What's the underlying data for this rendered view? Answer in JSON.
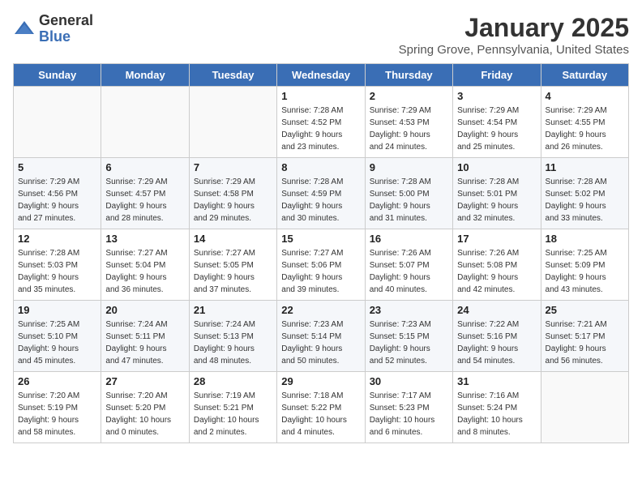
{
  "logo": {
    "general": "General",
    "blue": "Blue"
  },
  "title": "January 2025",
  "location": "Spring Grove, Pennsylvania, United States",
  "days_of_week": [
    "Sunday",
    "Monday",
    "Tuesday",
    "Wednesday",
    "Thursday",
    "Friday",
    "Saturday"
  ],
  "weeks": [
    [
      {
        "day": "",
        "info": ""
      },
      {
        "day": "",
        "info": ""
      },
      {
        "day": "",
        "info": ""
      },
      {
        "day": "1",
        "info": "Sunrise: 7:28 AM\nSunset: 4:52 PM\nDaylight: 9 hours\nand 23 minutes."
      },
      {
        "day": "2",
        "info": "Sunrise: 7:29 AM\nSunset: 4:53 PM\nDaylight: 9 hours\nand 24 minutes."
      },
      {
        "day": "3",
        "info": "Sunrise: 7:29 AM\nSunset: 4:54 PM\nDaylight: 9 hours\nand 25 minutes."
      },
      {
        "day": "4",
        "info": "Sunrise: 7:29 AM\nSunset: 4:55 PM\nDaylight: 9 hours\nand 26 minutes."
      }
    ],
    [
      {
        "day": "5",
        "info": "Sunrise: 7:29 AM\nSunset: 4:56 PM\nDaylight: 9 hours\nand 27 minutes."
      },
      {
        "day": "6",
        "info": "Sunrise: 7:29 AM\nSunset: 4:57 PM\nDaylight: 9 hours\nand 28 minutes."
      },
      {
        "day": "7",
        "info": "Sunrise: 7:29 AM\nSunset: 4:58 PM\nDaylight: 9 hours\nand 29 minutes."
      },
      {
        "day": "8",
        "info": "Sunrise: 7:28 AM\nSunset: 4:59 PM\nDaylight: 9 hours\nand 30 minutes."
      },
      {
        "day": "9",
        "info": "Sunrise: 7:28 AM\nSunset: 5:00 PM\nDaylight: 9 hours\nand 31 minutes."
      },
      {
        "day": "10",
        "info": "Sunrise: 7:28 AM\nSunset: 5:01 PM\nDaylight: 9 hours\nand 32 minutes."
      },
      {
        "day": "11",
        "info": "Sunrise: 7:28 AM\nSunset: 5:02 PM\nDaylight: 9 hours\nand 33 minutes."
      }
    ],
    [
      {
        "day": "12",
        "info": "Sunrise: 7:28 AM\nSunset: 5:03 PM\nDaylight: 9 hours\nand 35 minutes."
      },
      {
        "day": "13",
        "info": "Sunrise: 7:27 AM\nSunset: 5:04 PM\nDaylight: 9 hours\nand 36 minutes."
      },
      {
        "day": "14",
        "info": "Sunrise: 7:27 AM\nSunset: 5:05 PM\nDaylight: 9 hours\nand 37 minutes."
      },
      {
        "day": "15",
        "info": "Sunrise: 7:27 AM\nSunset: 5:06 PM\nDaylight: 9 hours\nand 39 minutes."
      },
      {
        "day": "16",
        "info": "Sunrise: 7:26 AM\nSunset: 5:07 PM\nDaylight: 9 hours\nand 40 minutes."
      },
      {
        "day": "17",
        "info": "Sunrise: 7:26 AM\nSunset: 5:08 PM\nDaylight: 9 hours\nand 42 minutes."
      },
      {
        "day": "18",
        "info": "Sunrise: 7:25 AM\nSunset: 5:09 PM\nDaylight: 9 hours\nand 43 minutes."
      }
    ],
    [
      {
        "day": "19",
        "info": "Sunrise: 7:25 AM\nSunset: 5:10 PM\nDaylight: 9 hours\nand 45 minutes."
      },
      {
        "day": "20",
        "info": "Sunrise: 7:24 AM\nSunset: 5:11 PM\nDaylight: 9 hours\nand 47 minutes."
      },
      {
        "day": "21",
        "info": "Sunrise: 7:24 AM\nSunset: 5:13 PM\nDaylight: 9 hours\nand 48 minutes."
      },
      {
        "day": "22",
        "info": "Sunrise: 7:23 AM\nSunset: 5:14 PM\nDaylight: 9 hours\nand 50 minutes."
      },
      {
        "day": "23",
        "info": "Sunrise: 7:23 AM\nSunset: 5:15 PM\nDaylight: 9 hours\nand 52 minutes."
      },
      {
        "day": "24",
        "info": "Sunrise: 7:22 AM\nSunset: 5:16 PM\nDaylight: 9 hours\nand 54 minutes."
      },
      {
        "day": "25",
        "info": "Sunrise: 7:21 AM\nSunset: 5:17 PM\nDaylight: 9 hours\nand 56 minutes."
      }
    ],
    [
      {
        "day": "26",
        "info": "Sunrise: 7:20 AM\nSunset: 5:19 PM\nDaylight: 9 hours\nand 58 minutes."
      },
      {
        "day": "27",
        "info": "Sunrise: 7:20 AM\nSunset: 5:20 PM\nDaylight: 10 hours\nand 0 minutes."
      },
      {
        "day": "28",
        "info": "Sunrise: 7:19 AM\nSunset: 5:21 PM\nDaylight: 10 hours\nand 2 minutes."
      },
      {
        "day": "29",
        "info": "Sunrise: 7:18 AM\nSunset: 5:22 PM\nDaylight: 10 hours\nand 4 minutes."
      },
      {
        "day": "30",
        "info": "Sunrise: 7:17 AM\nSunset: 5:23 PM\nDaylight: 10 hours\nand 6 minutes."
      },
      {
        "day": "31",
        "info": "Sunrise: 7:16 AM\nSunset: 5:24 PM\nDaylight: 10 hours\nand 8 minutes."
      },
      {
        "day": "",
        "info": ""
      }
    ]
  ]
}
